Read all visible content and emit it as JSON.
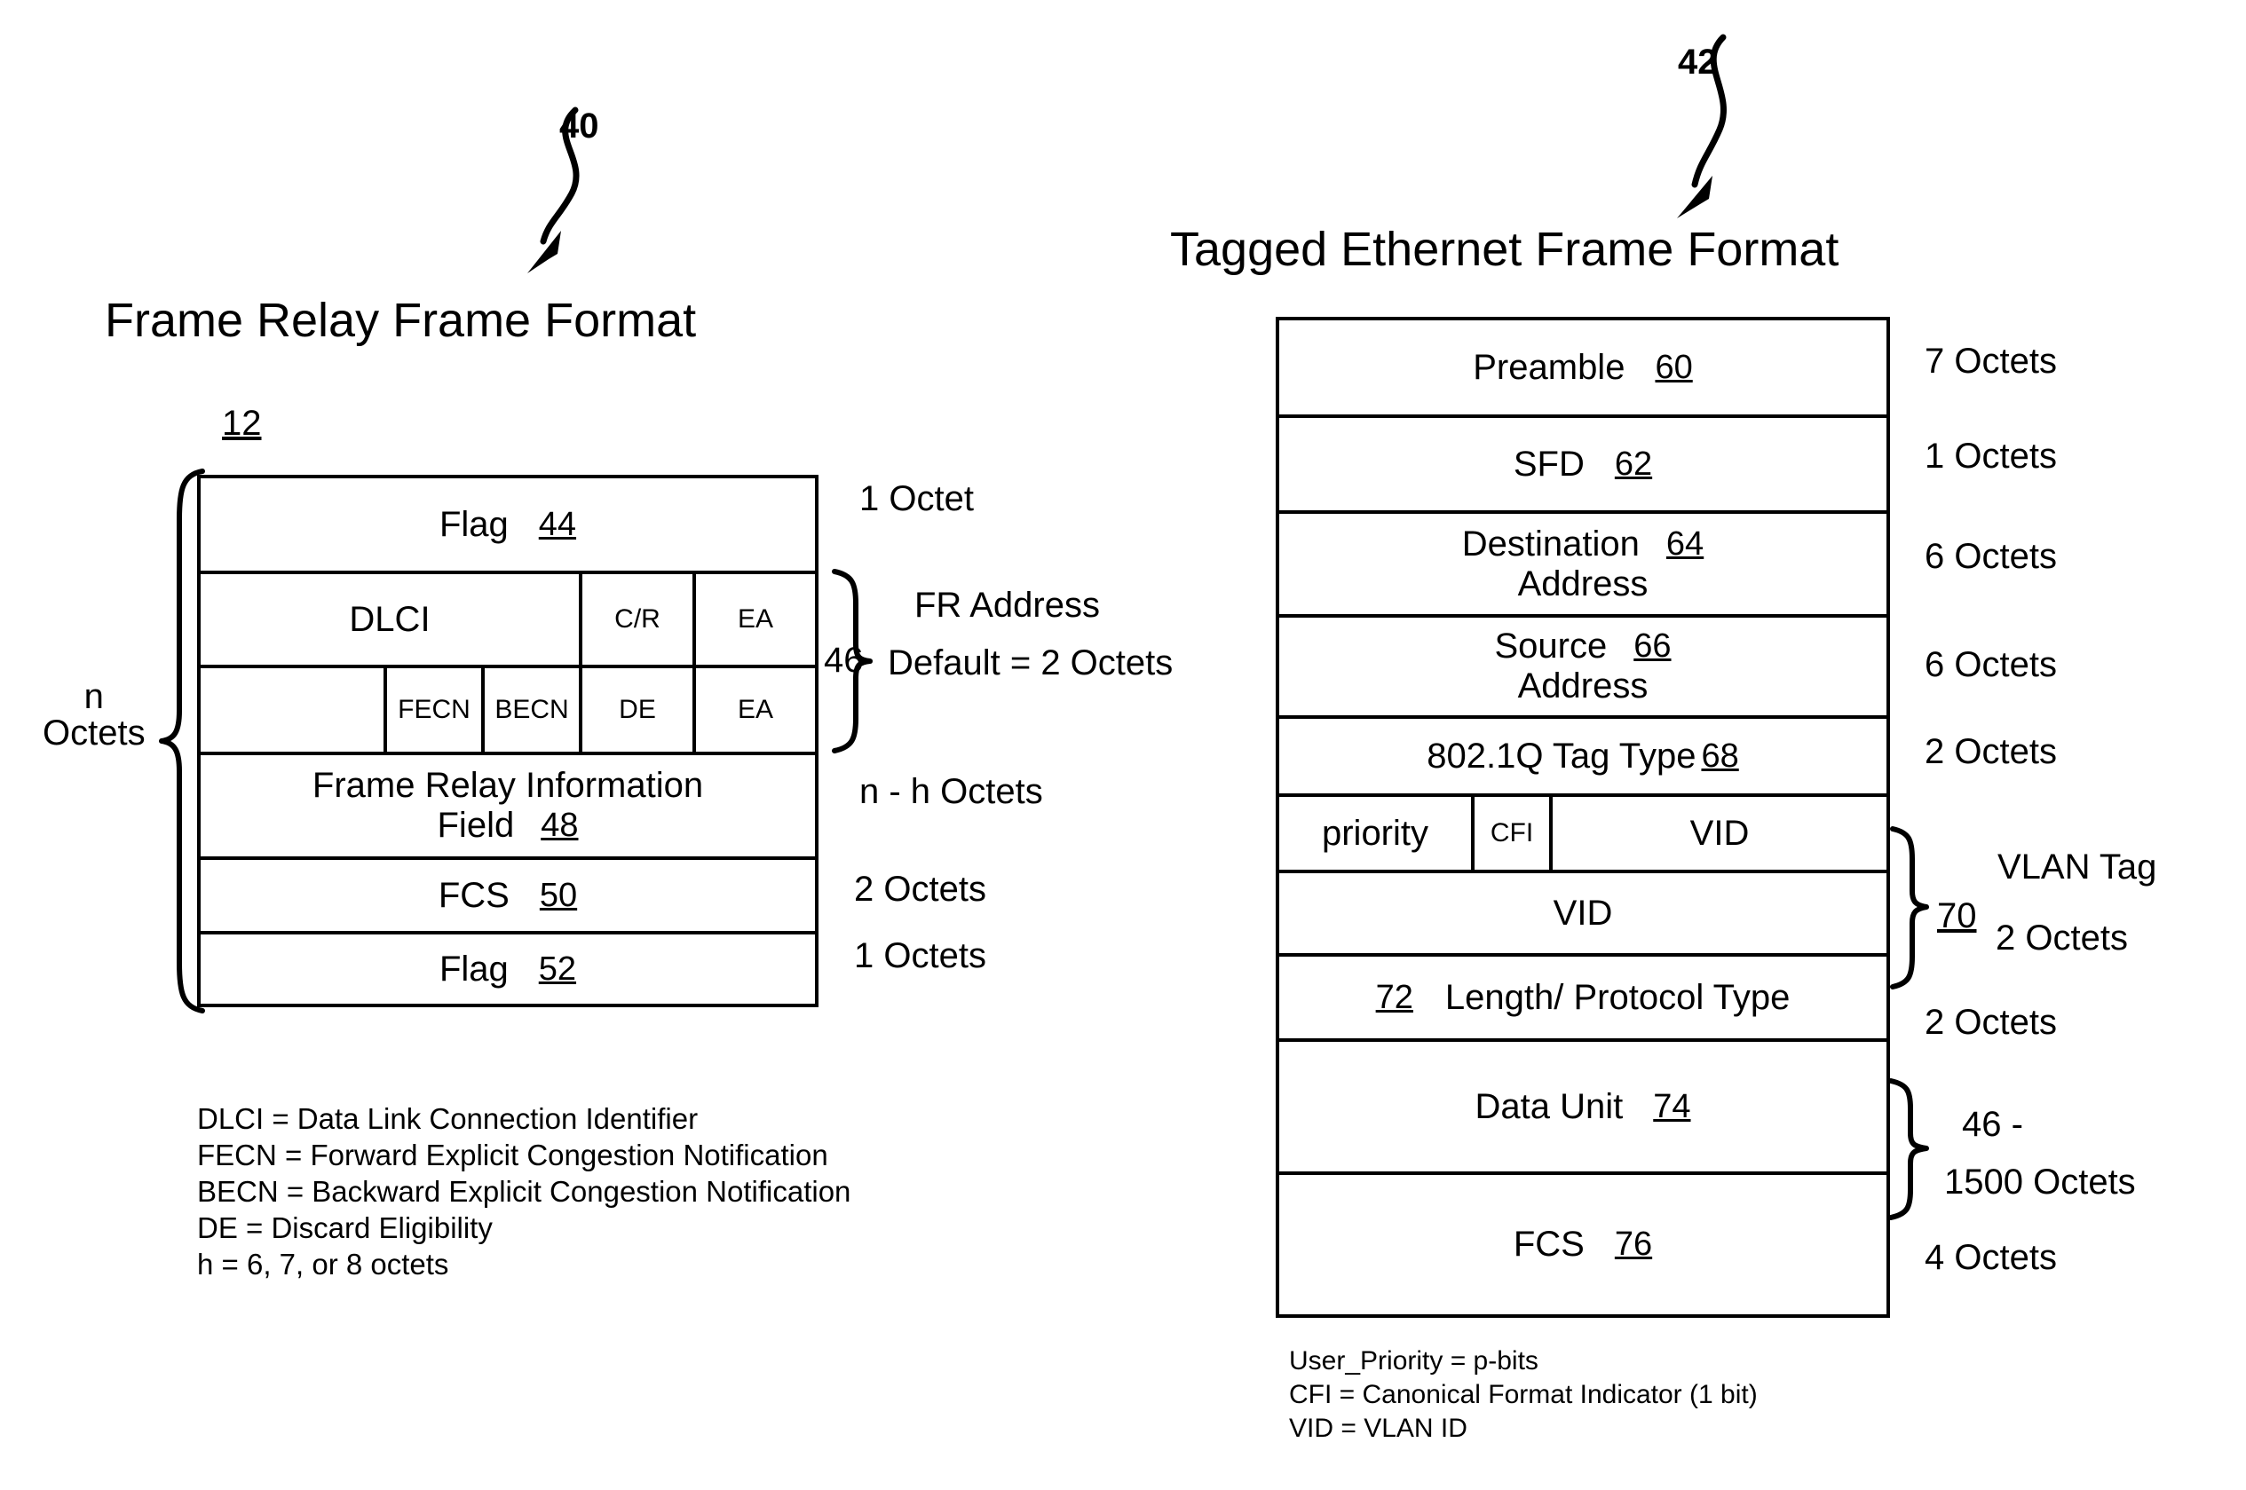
{
  "figures": [
    {
      "id": "frame-relay",
      "lead_ref": "40",
      "title": "Frame Relay Frame Format",
      "table_ref": "12",
      "outer_brace_label_line1": "n",
      "outer_brace_label_line2": "Octets",
      "rows": [
        {
          "label": "Flag",
          "ref": "44",
          "size": "1  Octet"
        },
        {
          "label": "DLCI",
          "ref": "",
          "sub_cells": [
            "C/R",
            "EA"
          ],
          "size": ""
        },
        {
          "label": "",
          "ref": "",
          "sub_cells": [
            "FECN",
            "BECN",
            "DE",
            "EA"
          ],
          "size": ""
        },
        {
          "label": "Frame Relay Information",
          "label2": "Field",
          "ref": "48",
          "size": "n - h  Octets"
        },
        {
          "label": "FCS",
          "ref": "50",
          "size": "2  Octets"
        },
        {
          "label": "Flag",
          "ref": "52",
          "size": "1  Octets"
        }
      ],
      "address_brace": {
        "ref": "46",
        "line1": "FR Address",
        "line2": "Default = 2 Octets"
      },
      "legend": [
        "DLCI = Data Link Connection Identifier",
        "FECN = Forward Explicit Congestion Notification",
        "BECN = Backward Explicit Congestion Notification",
        "DE = Discard Eligibility",
        "h = 6, 7, or 8 octets"
      ]
    },
    {
      "id": "tagged-ethernet",
      "lead_ref": "42",
      "title": "Tagged Ethernet Frame Format",
      "rows": [
        {
          "label": "Preamble",
          "ref": "60",
          "size": "7 Octets"
        },
        {
          "label": "SFD",
          "ref": "62",
          "size": "1 Octets"
        },
        {
          "label": "Destination",
          "label2": "Address",
          "ref": "64",
          "size": "6  Octets"
        },
        {
          "label": "Source",
          "label2": "Address",
          "ref": "66",
          "size": "6  Octets"
        },
        {
          "label": "802.1Q Tag Type",
          "ref": "68",
          "size": "2  Octets"
        },
        {
          "label": "",
          "ref": "",
          "sub_cells": [
            "priority",
            "CFI",
            "VID"
          ],
          "size": ""
        },
        {
          "label": "VID",
          "ref": "",
          "size": ""
        },
        {
          "label": "Length/ Protocol Type",
          "ref": "72",
          "ref_position": "left",
          "size": "2  Octets"
        },
        {
          "label": "Data Unit",
          "ref": "74",
          "size": ""
        },
        {
          "label": "FCS",
          "ref": "76",
          "size": "4  Octets"
        }
      ],
      "vlan_brace": {
        "ref": "70",
        "line1": "VLAN Tag",
        "line2": "2  Octets"
      },
      "data_brace": {
        "line1": "46 -",
        "line2": "1500 Octets"
      },
      "legend": [
        "User_Priority = p-bits",
        "CFI = Canonical Format Indicator (1 bit)",
        "VID = VLAN ID"
      ]
    }
  ]
}
